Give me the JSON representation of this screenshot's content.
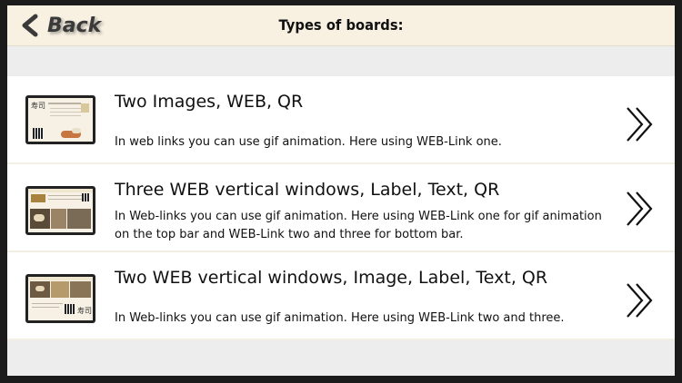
{
  "header": {
    "back_label": "Back",
    "title": "Types of boards:"
  },
  "boards": [
    {
      "title": "Two Images, WEB, QR",
      "description": "In web links you can use gif animation. Here using WEB-Link one.",
      "thumbnail_caption": "寿司"
    },
    {
      "title": "Three WEB vertical windows, Label, Text, QR",
      "description": "In Web-links you can use gif animation. Here using WEB-Link one for gif animation on the top bar and WEB-Link two and three for bottom bar."
    },
    {
      "title": "Two WEB vertical windows, Image, Label, Text, QR",
      "description": "In Web-links you can use gif animation. Here using WEB-Link two and three.",
      "thumbnail_caption": "寿司"
    }
  ],
  "icons": {
    "back": "chevron-left-icon",
    "row_action": "double-chevron-right-icon"
  }
}
